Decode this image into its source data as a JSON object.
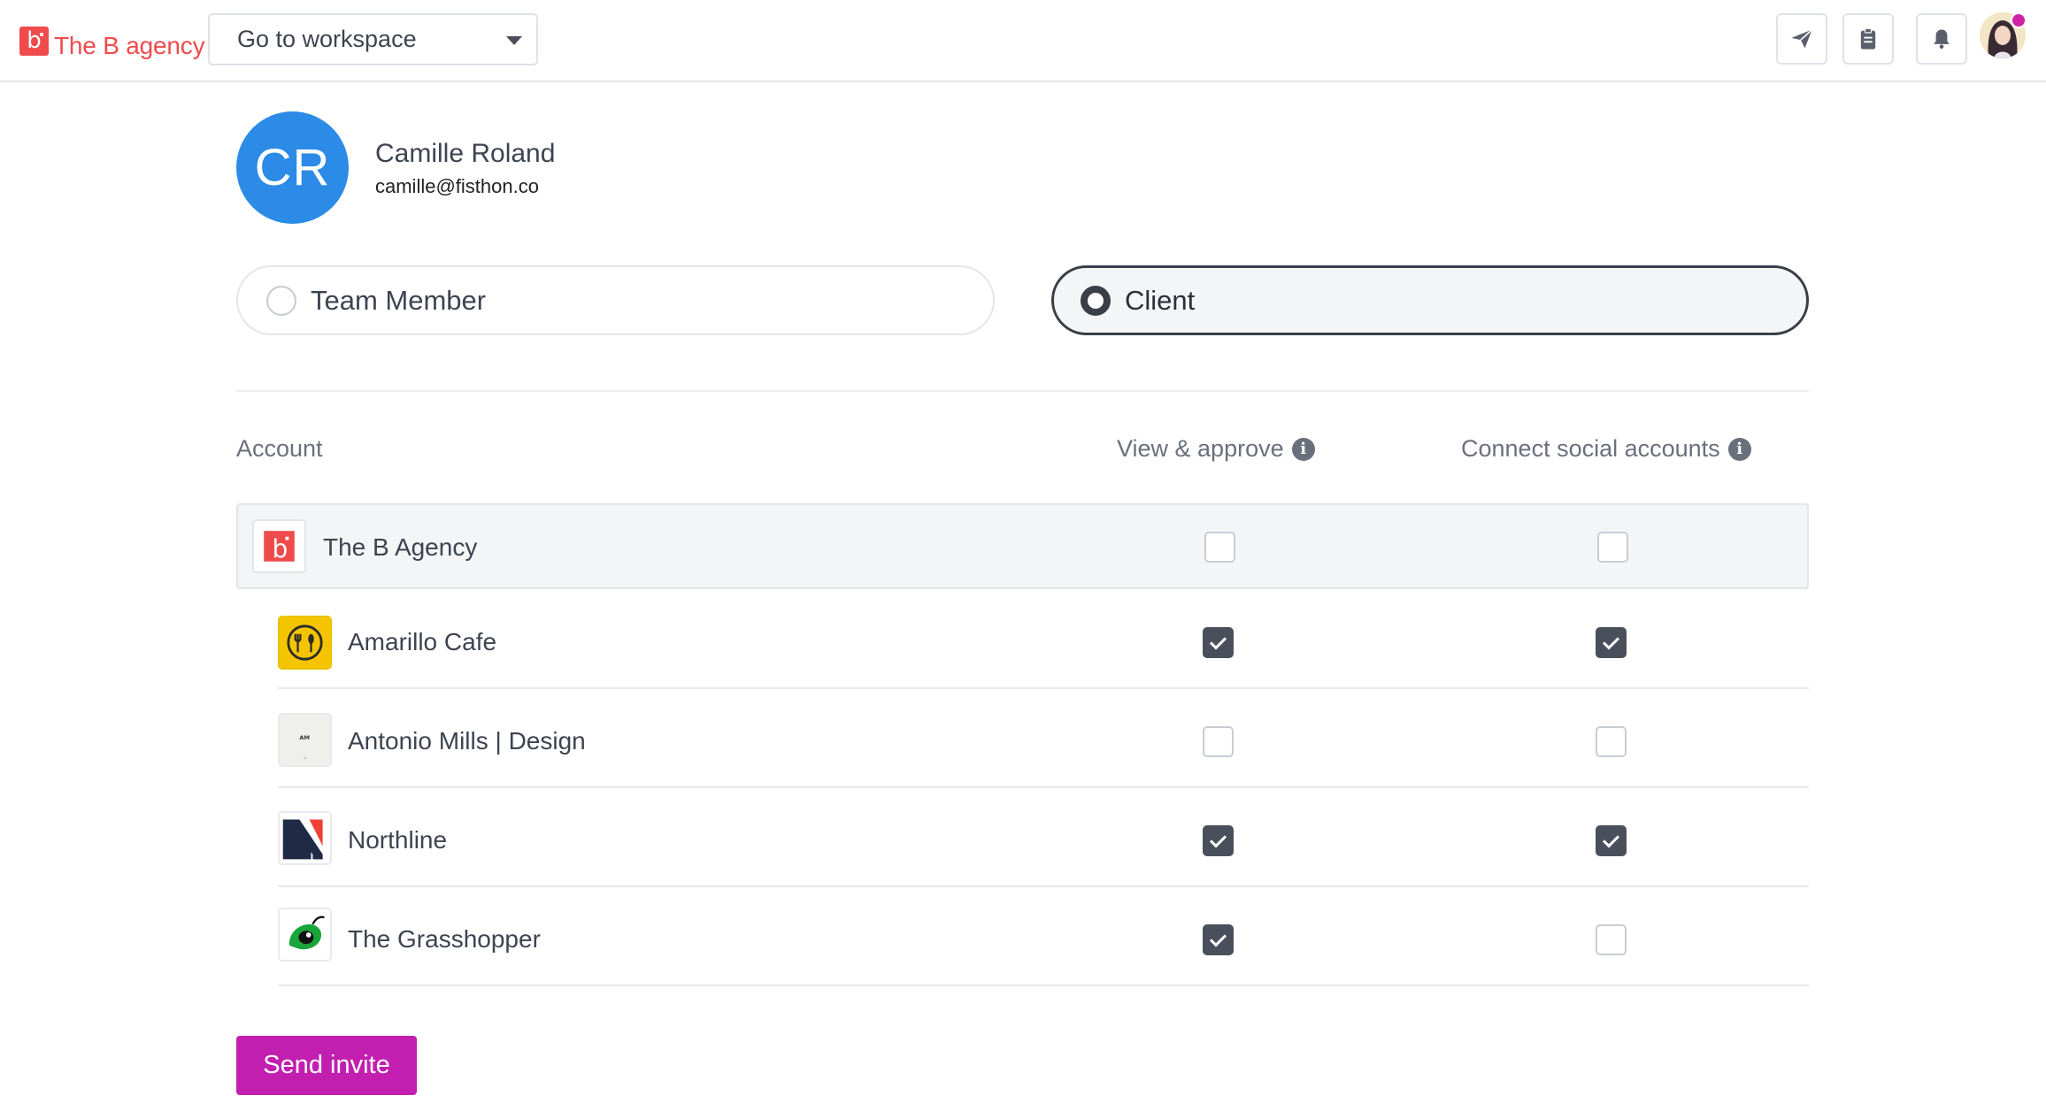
{
  "header": {
    "brand_name": "The B agency",
    "brand_mark": "b",
    "workspace_select": "Go to workspace",
    "icons": [
      "send-icon",
      "clipboard-icon",
      "bell-icon"
    ]
  },
  "profile": {
    "initials": "CR",
    "name": "Camille Roland",
    "email": "camille@fisthon.co"
  },
  "roles": {
    "team_member": "Team Member",
    "client": "Client",
    "selected": "Client"
  },
  "table": {
    "headers": {
      "account": "Account",
      "view_approve": "View & approve",
      "connect_social": "Connect social accounts"
    },
    "rows": [
      {
        "name": "The B Agency",
        "view_approve": false,
        "connect_social": false
      },
      {
        "name": "Amarillo Cafe",
        "view_approve": true,
        "connect_social": true
      },
      {
        "name": "Antonio Mills | Design",
        "view_approve": false,
        "connect_social": false
      },
      {
        "name": "Northline",
        "view_approve": true,
        "connect_social": true
      },
      {
        "name": "The Grasshopper",
        "view_approve": true,
        "connect_social": false
      }
    ]
  },
  "actions": {
    "send_invite": "Send invite"
  },
  "colors": {
    "brand": "#f04b4b",
    "accent": "#c21fb0",
    "avatar": "#2b8be6",
    "checked": "#4a505b"
  }
}
